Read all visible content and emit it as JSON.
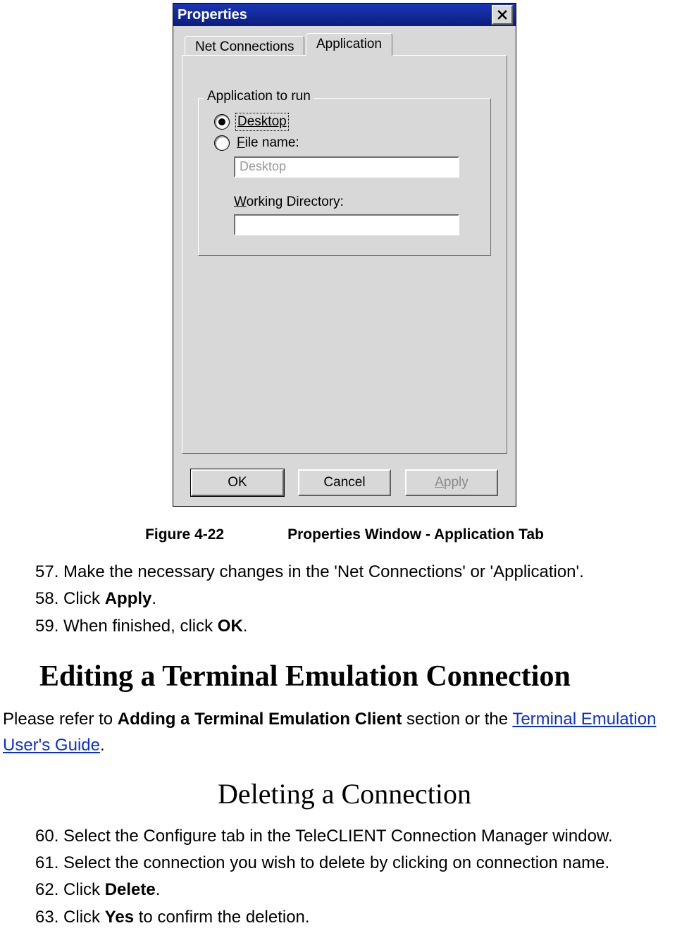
{
  "dialog": {
    "title": "Properties",
    "tabs": {
      "inactive": "Net Connections",
      "active": "Application"
    },
    "group_legend": "Application to run",
    "radios": {
      "desktop": "Desktop",
      "filename": "File name:"
    },
    "filename_value": "Desktop",
    "working_dir_label": "Working Directory:",
    "working_dir_value": "",
    "buttons": {
      "ok": "OK",
      "cancel": "Cancel",
      "apply": "Apply"
    }
  },
  "caption": {
    "fig": "Figure 4-22",
    "title": "Properties Window - Application Tab"
  },
  "steps_a": {
    "s57": "57. Make the necessary changes in the 'Net Connections' or 'Application'.",
    "s58_pre": "58. Click ",
    "s58_b": "Apply",
    "s58_post": ".",
    "s59_pre": "59. When finished, click ",
    "s59_b": "OK",
    "s59_post": "."
  },
  "heading_editing": "Editing a Terminal Emulation Connection",
  "para": {
    "pre": "Please refer to ",
    "bold": "Adding a Terminal Emulation Client",
    "mid": " section or the ",
    "link": "Terminal Emulation User's Guide",
    "post": "."
  },
  "heading_deleting": "Deleting a Connection",
  "steps_b": {
    "s60": "60. Select the Configure tab in the TeleCLIENT Connection Manager window.",
    "s61": "61. Select the connection you wish to delete by clicking on connection name.",
    "s62_pre": "62. Click ",
    "s62_b": "Delete",
    "s62_post": ".",
    "s63_pre": "63. Click ",
    "s63_b": "Yes",
    "s63_post": " to confirm the deletion."
  }
}
